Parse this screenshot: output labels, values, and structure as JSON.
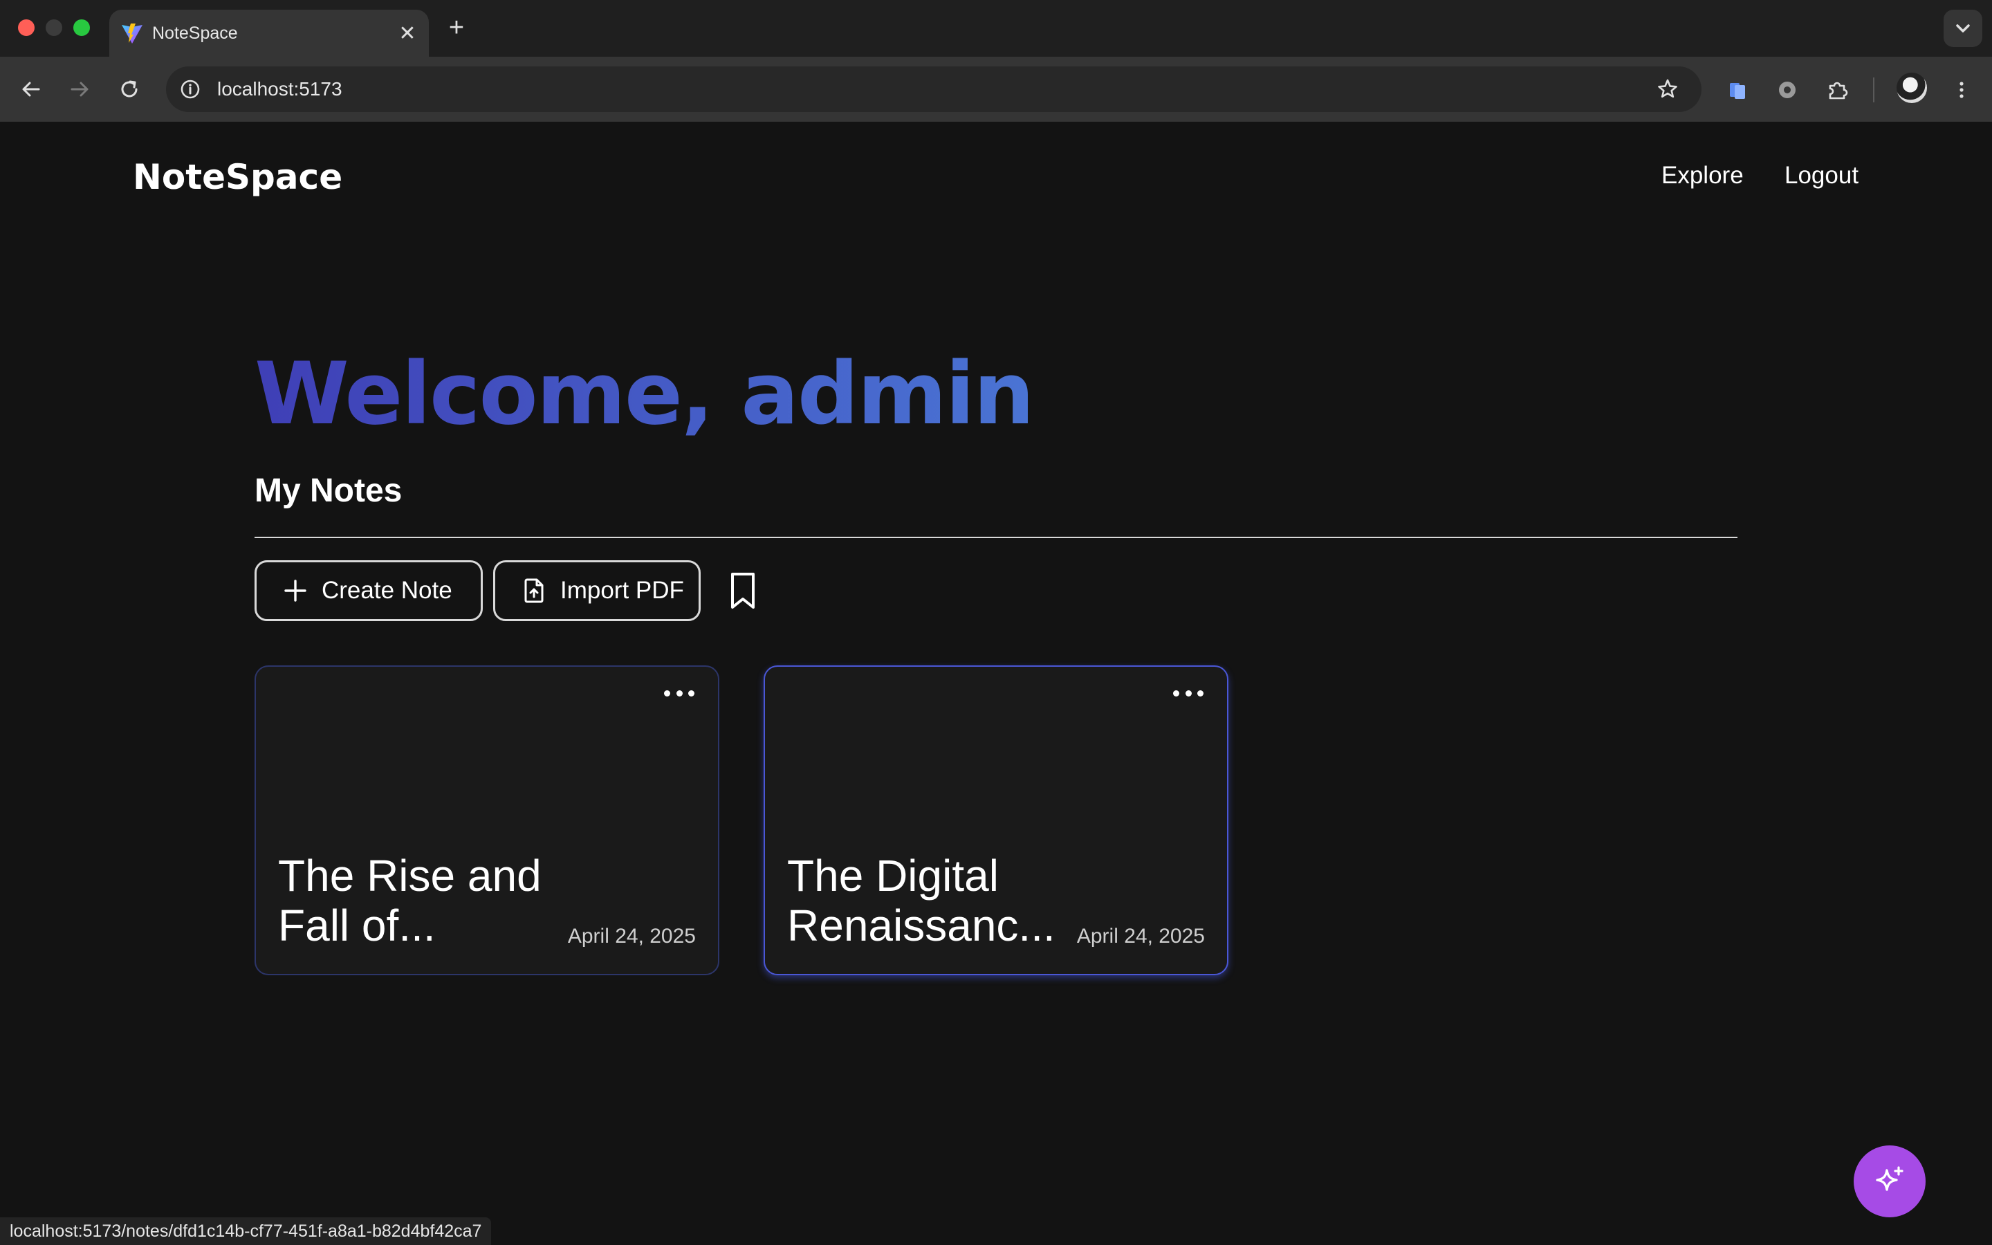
{
  "browser": {
    "tab_title": "NoteSpace",
    "tab_close": "✕",
    "new_tab": "+",
    "url": "localhost:5173",
    "status_url": "localhost:5173/notes/dfd1c14b-cf77-451f-a8a1-b82d4bf42ca7"
  },
  "app": {
    "logo": "NoteSpace",
    "nav": {
      "explore": "Explore",
      "logout": "Logout"
    },
    "welcome": "Welcome, admin",
    "section_title": "My Notes",
    "actions": {
      "create": "Create Note",
      "import": "Import PDF"
    },
    "notes": [
      {
        "title": "The Rise and Fall of...",
        "date": "April 24, 2025"
      },
      {
        "title": "The Digital Renaissanc...",
        "date": "April 24, 2025"
      }
    ]
  },
  "colors": {
    "welcome_gradient_start": "#3f3fb6",
    "welcome_gradient_end": "#4a74d4",
    "card_border": "#2c3569",
    "card_border_active": "#4a57d6",
    "fab": "#a64be6"
  },
  "icons": {
    "back": "arrow-left-icon",
    "forward": "arrow-right-icon",
    "reload": "reload-icon",
    "info": "info-icon",
    "star": "star-icon",
    "create": "plus-icon",
    "import": "file-upload-icon",
    "bookmark": "bookmark-icon",
    "menu": "more-horizontal-icon",
    "fab": "sparkles-icon"
  }
}
